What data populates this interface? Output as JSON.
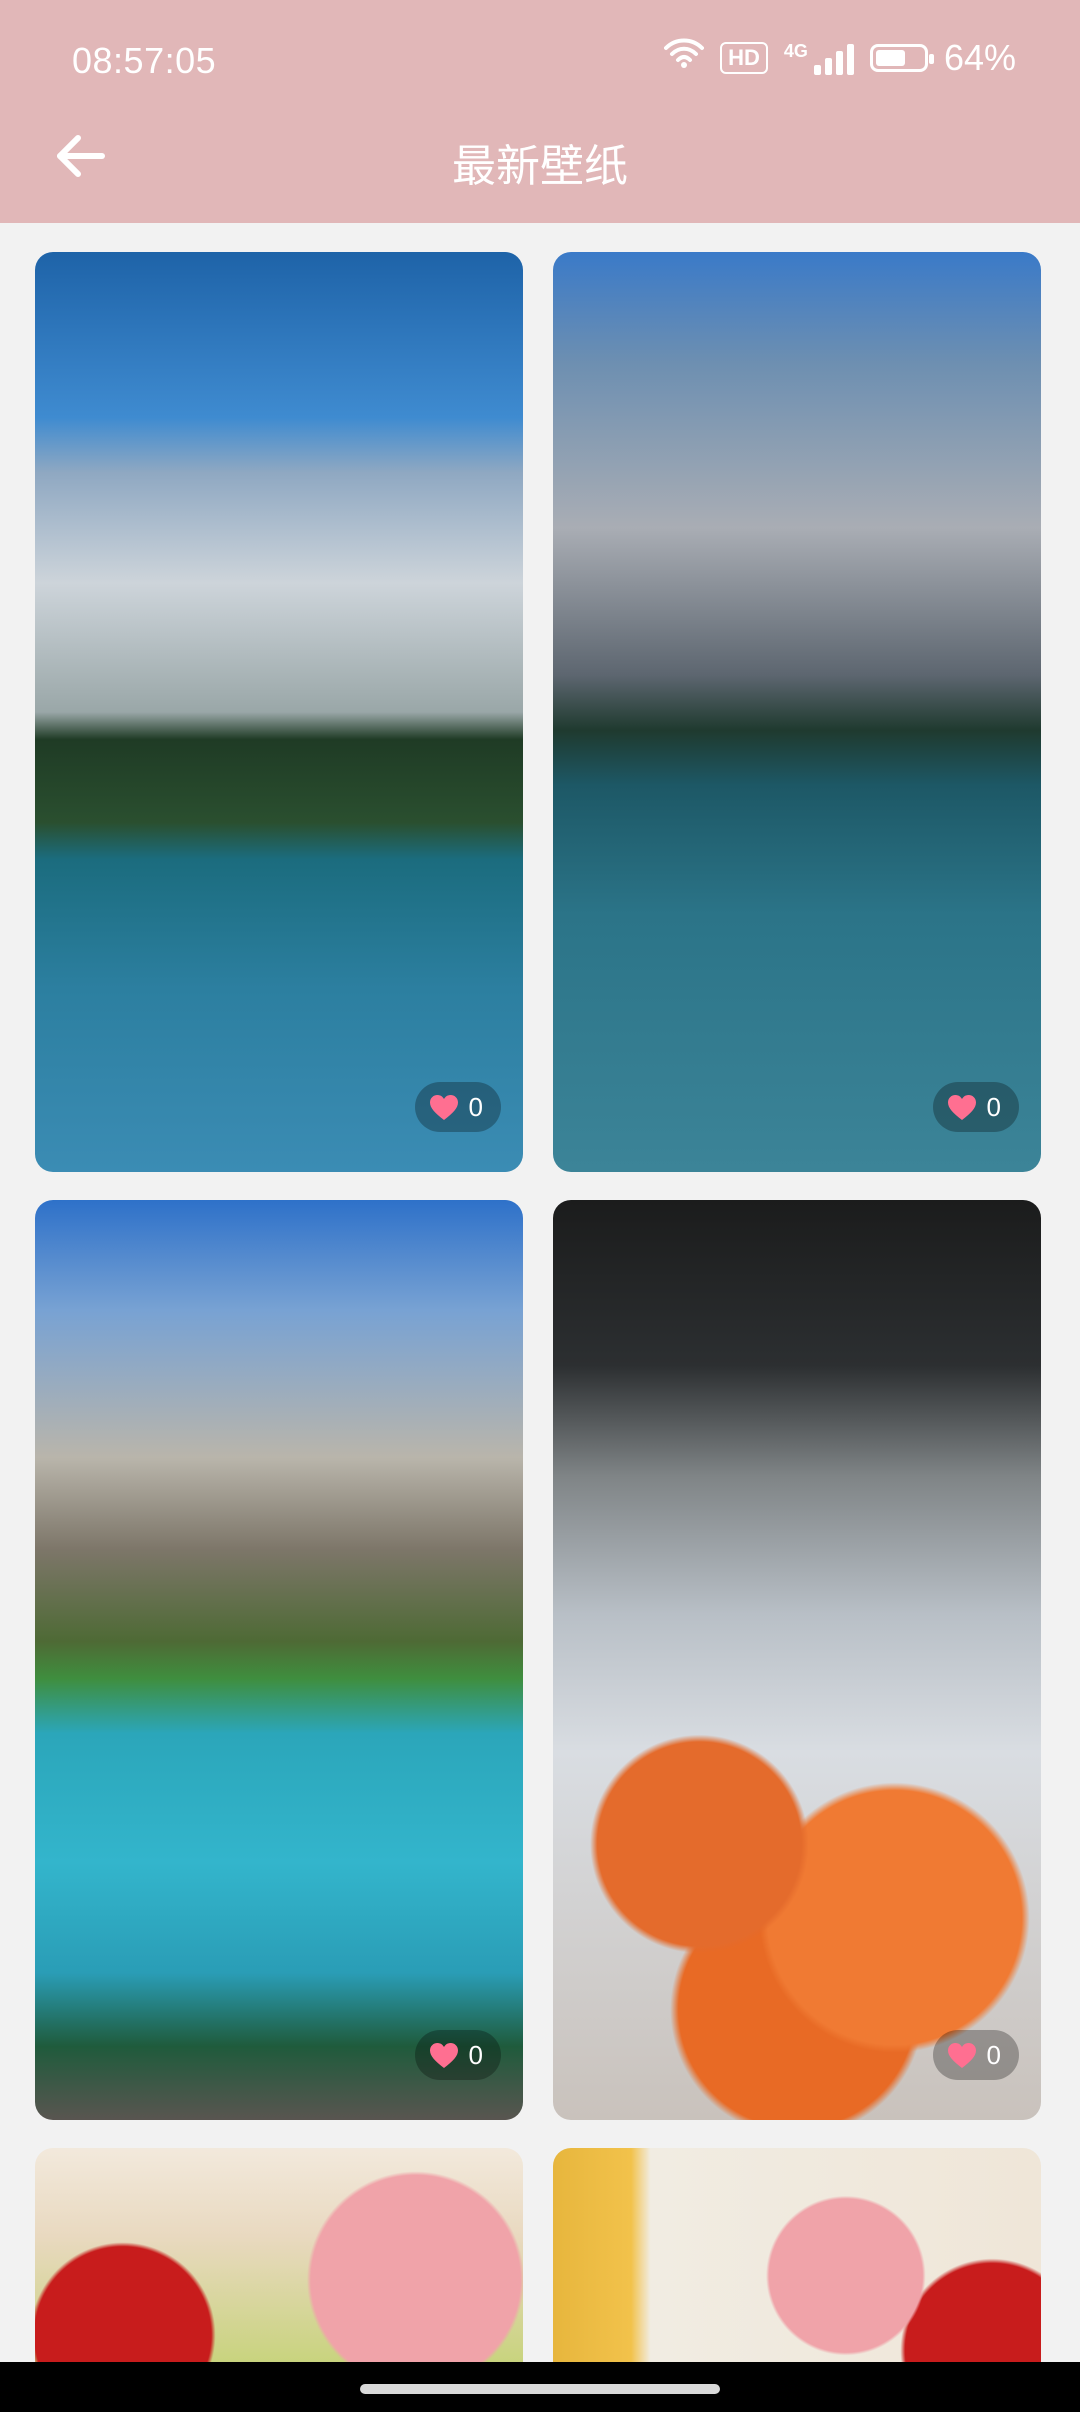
{
  "status_bar": {
    "time": "08:57:05",
    "hd_label": "HD",
    "network_label": "4G",
    "battery_text": "64%",
    "battery_level": 0.64,
    "icons": [
      "wifi-icon",
      "hd-icon",
      "signal-icon",
      "battery-icon"
    ]
  },
  "header": {
    "title": "最新壁纸",
    "back_icon": "arrow-left-icon",
    "background": "#e1b7b8"
  },
  "wallpapers": [
    {
      "subject": "mountain lake with forest",
      "likes": "0"
    },
    {
      "subject": "mountain lake with canoes",
      "likes": "0"
    },
    {
      "subject": "turquoise mountain lake",
      "likes": "0"
    },
    {
      "subject": "goldfish in glass bowl",
      "likes": "0"
    },
    {
      "subject": "cakes",
      "likes": ""
    },
    {
      "subject": "cakes and drink",
      "likes": ""
    }
  ],
  "colors": {
    "like_heart": "#ff6f91",
    "page_background": "#f2f2f2"
  }
}
